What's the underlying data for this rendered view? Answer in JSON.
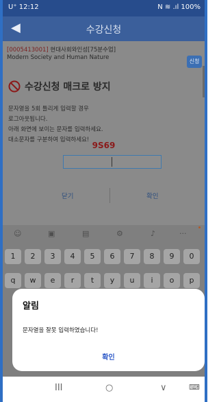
{
  "status_bar": {
    "time": "U⁺ 12:12",
    "right": "N ≋ .ıl 100%"
  },
  "app_header": {
    "title": "수강신청"
  },
  "course": {
    "code": "[0005413001]",
    "title_ko": "현대사회와인성[75분수업]",
    "title_en": "Modern Society and Human Nature",
    "apply_label": "신청"
  },
  "popup": {
    "heading": "수강신청 매크로 방지",
    "lines": [
      "문자열을 5회 틀리게 입력할 경우",
      "로그아웃됩니다.",
      "아래 화면에 보이는 문자를 입력하세요.",
      "대소문자를 구분하여 입력하세요!"
    ],
    "captcha": "9S69",
    "close": "닫기",
    "confirm": "확인"
  },
  "keyboard": {
    "number_row": [
      "1",
      "2",
      "3",
      "4",
      "5",
      "6",
      "7",
      "8",
      "9",
      "0"
    ],
    "letter_row": [
      "q",
      "w",
      "e",
      "r",
      "t",
      "y",
      "u",
      "i",
      "o",
      "p"
    ],
    "more": "···"
  },
  "alert": {
    "title": "알림",
    "message": "문자열을 잘못 입력하였습니다!",
    "ok": "확인"
  },
  "nav": {
    "recent": "III",
    "home": "○",
    "back": "∨",
    "keyboard": "⌨"
  },
  "colors": {
    "frame": "#2f6fc4",
    "header": "#3b5f9b",
    "captcha": "#8b1a1a",
    "alert_button": "#2f5bc8"
  }
}
